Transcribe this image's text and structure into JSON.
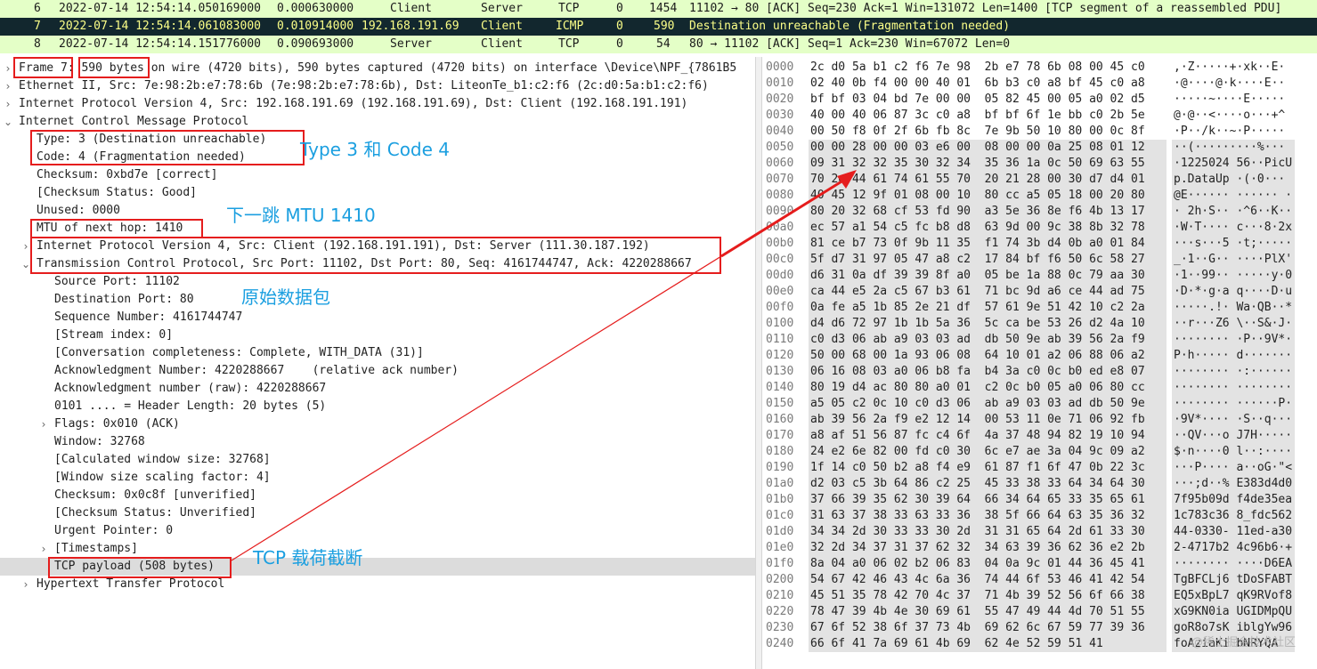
{
  "packet_list": [
    {
      "no": "6",
      "time": "2022-07-14 12:54:14.050169000",
      "delta": "0.000630000",
      "src": "Client",
      "dst": "Server",
      "proto": "TCP",
      "x": "0",
      "len": "1454",
      "info": "11102 → 80 [ACK] Seq=230 Ack=1 Win=131072 Len=1400 [TCP segment of a reassembled PDU]"
    },
    {
      "no": "7",
      "time": "2022-07-14 12:54:14.061083000",
      "delta": "0.010914000",
      "src": "192.168.191.69",
      "dst": "Client",
      "proto": "ICMP",
      "x": "0",
      "len": "590",
      "info": "Destination unreachable (Fragmentation needed)"
    },
    {
      "no": "8",
      "time": "2022-07-14 12:54:14.151776000",
      "delta": "0.090693000",
      "src": "Server",
      "dst": "Client",
      "proto": "TCP",
      "x": "0",
      "len": "54",
      "info": "80 → 11102 [ACK] Seq=1 Ack=230 Win=67072 Len=0"
    }
  ],
  "details": {
    "frame": "Frame 7: 590 bytes on wire (4720 bits), 590 bytes captured (4720 bits) on interface \\Device\\NPF_{7861B5",
    "ethernet": "Ethernet II, Src: 7e:98:2b:e7:78:6b (7e:98:2b:e7:78:6b), Dst: LiteonTe_b1:c2:f6 (2c:d0:5a:b1:c2:f6)",
    "ipv4": "Internet Protocol Version 4, Src: 192.168.191.69 (192.168.191.69), Dst: Client (192.168.191.191)",
    "icmp": "Internet Control Message Protocol",
    "type": "Type: 3 (Destination unreachable)",
    "code": "Code: 4 (Fragmentation needed)",
    "checksum": "Checksum: 0xbd7e [correct]",
    "checksum_status": "[Checksum Status: Good]",
    "unused": "Unused: 0000",
    "mtu": "MTU of next hop: 1410",
    "inner_ip": "Internet Protocol Version 4, Src: Client (192.168.191.191), Dst: Server (111.30.187.192)",
    "inner_tcp": "Transmission Control Protocol, Src Port: 11102, Dst Port: 80, Seq: 4161744747, Ack: 4220288667",
    "src_port": "Source Port: 11102",
    "dst_port": "Destination Port: 80",
    "seq": "Sequence Number: 4161744747",
    "stream": "[Stream index: 0]",
    "conv": "[Conversation completeness: Complete, WITH_DATA (31)]",
    "ack": "Acknowledgment Number: 4220288667    (relative ack number)",
    "ack_raw": "Acknowledgment number (raw): 4220288667",
    "hdr_len": "0101 .... = Header Length: 20 bytes (5)",
    "flags": "Flags: 0x010 (ACK)",
    "window": "Window: 32768",
    "calc_win": "[Calculated window size: 32768]",
    "win_scale": "[Window size scaling factor: 4]",
    "tcp_checksum": "Checksum: 0x0c8f [unverified]",
    "tcp_checksum_status": "[Checksum Status: Unverified]",
    "urgent": "Urgent Pointer: 0",
    "timestamps": "[Timestamps]",
    "payload": "TCP payload (508 bytes)",
    "http": "Hypertext Transfer Protocol"
  },
  "annotations": {
    "type_code": "Type 3 和 Code 4",
    "mtu": "下一跳 MTU 1410",
    "original": "原始数据包",
    "payload": "TCP 载荷截断",
    "watermark": "@稀土掘金技术社区"
  },
  "hex": [
    {
      "off": "0000",
      "bytes": "2c d0 5a b1 c2 f6 7e 98  2b e7 78 6b 08 00 45 c0",
      "ascii": ",·Z·····+·xk··E·"
    },
    {
      "off": "0010",
      "bytes": "02 40 0b f4 00 00 40 01  6b b3 c0 a8 bf 45 c0 a8",
      "ascii": "·@····@·k····E··"
    },
    {
      "off": "0020",
      "bytes": "bf bf 03 04 bd 7e 00 00  05 82 45 00 05 a0 02 d5",
      "ascii": "·····~····E·····"
    },
    {
      "off": "0030",
      "bytes": "40 00 40 06 87 3c c0 a8  bf bf 6f 1e bb c0 2b 5e",
      "ascii": "@·@··<····o···+^"
    },
    {
      "off": "0040",
      "bytes": "00 50 f8 0f 2f 6b fb 8c  7e 9b 50 10 80 00 0c 8f",
      "ascii": "·P··/k··~·P·····"
    },
    {
      "off": "0050",
      "bytes": "00 00 28 00 00 03 e6 00  08 00 00 0a 25 08 01 12",
      "ascii": "··(·········%···"
    },
    {
      "off": "0060",
      "bytes": "09 31 32 32 35 30 32 34  35 36 1a 0c 50 69 63 55",
      "ascii": "·1225024 56··PicU"
    },
    {
      "off": "0070",
      "bytes": "70 2e 44 61 74 61 55 70  20 21 28 00 30 d7 d4 01",
      "ascii": "p.DataUp ·(·0···"
    },
    {
      "off": "0080",
      "bytes": "40 45 12 9f 01 08 00 10  80 cc a5 05 18 00 20 80",
      "ascii": "@E······ ······ ·"
    },
    {
      "off": "0090",
      "bytes": "80 20 32 68 cf 53 fd 90  a3 5e 36 8e f6 4b 13 17",
      "ascii": "· 2h·S·· ·^6··K··"
    },
    {
      "off": "00a0",
      "bytes": "ec 57 a1 54 c5 fc b8 d8  63 9d 00 9c 38 8b 32 78",
      "ascii": "·W·T···· c···8·2x"
    },
    {
      "off": "00b0",
      "bytes": "81 ce b7 73 0f 9b 11 35  f1 74 3b d4 0b a0 01 84",
      "ascii": "···s···5 ·t;·····"
    },
    {
      "off": "00c0",
      "bytes": "5f d7 31 97 05 47 a8 c2  17 84 bf f6 50 6c 58 27",
      "ascii": "_·1··G·· ····PlX'"
    },
    {
      "off": "00d0",
      "bytes": "d6 31 0a df 39 39 8f a0  05 be 1a 88 0c 79 aa 30",
      "ascii": "·1··99·· ·····y·0"
    },
    {
      "off": "00e0",
      "bytes": "ca 44 e5 2a c5 67 b3 61  71 bc 9d a6 ce 44 ad 75",
      "ascii": "·D·*·g·a q····D·u"
    },
    {
      "off": "00f0",
      "bytes": "0a fe a5 1b 85 2e 21 df  57 61 9e 51 42 10 c2 2a",
      "ascii": "·····.!· Wa·QB··*"
    },
    {
      "off": "0100",
      "bytes": "d4 d6 72 97 1b 1b 5a 36  5c ca be 53 26 d2 4a 10",
      "ascii": "··r···Z6 \\··S&·J·"
    },
    {
      "off": "0110",
      "bytes": "c0 d3 06 ab a9 03 03 ad  db 50 9e ab 39 56 2a f9",
      "ascii": "········ ·P··9V*·"
    },
    {
      "off": "0120",
      "bytes": "50 00 68 00 1a 93 06 08  64 10 01 a2 06 88 06 a2",
      "ascii": "P·h····· d·······"
    },
    {
      "off": "0130",
      "bytes": "06 16 08 03 a0 06 b8 fa  b4 3a c0 0c b0 ed e8 07",
      "ascii": "········ ·:······"
    },
    {
      "off": "0140",
      "bytes": "80 19 d4 ac 80 80 a0 01  c2 0c b0 05 a0 06 80 cc",
      "ascii": "········ ········"
    },
    {
      "off": "0150",
      "bytes": "a5 05 c2 0c 10 c0 d3 06  ab a9 03 03 ad db 50 9e",
      "ascii": "········ ······P·"
    },
    {
      "off": "0160",
      "bytes": "ab 39 56 2a f9 e2 12 14  00 53 11 0e 71 06 92 fb",
      "ascii": "·9V*···· ·S··q···"
    },
    {
      "off": "0170",
      "bytes": "a8 af 51 56 87 fc c4 6f  4a 37 48 94 82 19 10 94",
      "ascii": "··QV···o J7H·····"
    },
    {
      "off": "0180",
      "bytes": "24 e2 6e 82 00 fd c0 30  6c e7 ae 3a 04 9c 09 a2",
      "ascii": "$·n····0 l··:····"
    },
    {
      "off": "0190",
      "bytes": "1f 14 c0 50 b2 a8 f4 e9  61 87 f1 6f 47 0b 22 3c",
      "ascii": "···P···· a··oG·\"<"
    },
    {
      "off": "01a0",
      "bytes": "d2 03 c5 3b 64 86 c2 25  45 33 38 33 64 34 64 30",
      "ascii": "···;d··% E383d4d0"
    },
    {
      "off": "01b0",
      "bytes": "37 66 39 35 62 30 39 64  66 34 64 65 33 35 65 61",
      "ascii": "7f95b09d f4de35ea"
    },
    {
      "off": "01c0",
      "bytes": "31 63 37 38 33 63 33 36  38 5f 66 64 63 35 36 32",
      "ascii": "1c783c36 8_fdc562"
    },
    {
      "off": "01d0",
      "bytes": "34 34 2d 30 33 33 30 2d  31 31 65 64 2d 61 33 30",
      "ascii": "44-0330- 11ed-a30"
    },
    {
      "off": "01e0",
      "bytes": "32 2d 34 37 31 37 62 32  34 63 39 36 62 36 e2 2b",
      "ascii": "2-4717b2 4c96b6·+"
    },
    {
      "off": "01f0",
      "bytes": "8a 04 a0 06 02 b2 06 83  04 0a 9c 01 44 36 45 41",
      "ascii": "········ ····D6EA"
    },
    {
      "off": "0200",
      "bytes": "54 67 42 46 43 4c 6a 36  74 44 6f 53 46 41 42 54",
      "ascii": "TgBFCLj6 tDoSFABT"
    },
    {
      "off": "0210",
      "bytes": "45 51 35 78 42 70 4c 37  71 4b 39 52 56 6f 66 38",
      "ascii": "EQ5xBpL7 qK9RVof8"
    },
    {
      "off": "0220",
      "bytes": "78 47 39 4b 4e 30 69 61  55 47 49 44 4d 70 51 55",
      "ascii": "xG9KN0ia UGIDMpQU"
    },
    {
      "off": "0230",
      "bytes": "67 6f 52 38 6f 37 73 4b  69 62 6c 67 59 77 39 36",
      "ascii": "goR8o7sK iblgYw96"
    },
    {
      "off": "0240",
      "bytes": "66 6f 41 7a 69 61 4b 69  62 4e 52 59 51 41",
      "ascii": "foAziaKi bNRYQA"
    }
  ],
  "colors": {
    "accent_red": "#e51d1d",
    "note_blue": "#1b9fe0",
    "row_green": "#e4ffc7",
    "row_selected": "#12272e"
  }
}
